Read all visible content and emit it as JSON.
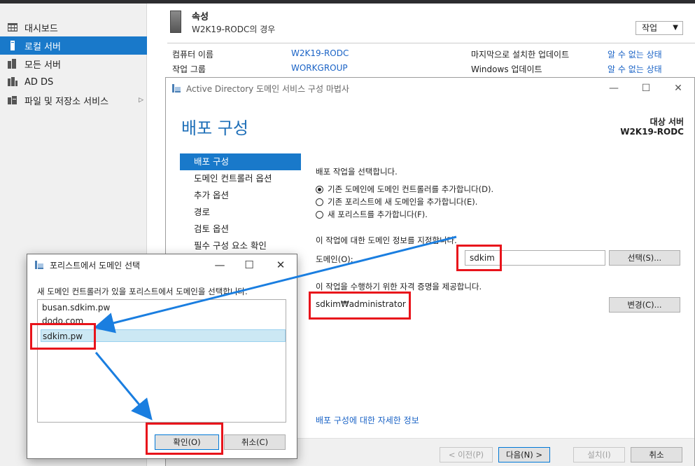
{
  "sidebar": {
    "items": [
      {
        "label": "대시보드",
        "icon": "dashboard-icon"
      },
      {
        "label": "로컬 서버",
        "icon": "server-icon"
      },
      {
        "label": "모든 서버",
        "icon": "servers-icon"
      },
      {
        "label": "AD DS",
        "icon": "ad-ds-icon"
      },
      {
        "label": "파일 및 저장소 서비스",
        "icon": "file-storage-icon",
        "expand": "▷"
      }
    ]
  },
  "properties": {
    "title": "속성",
    "subtitle": "W2K19-RODC의 경우",
    "task_button": "작업",
    "rows": [
      {
        "label": "컴퓨터 이름",
        "value": "W2K19-RODC",
        "label2": "마지막으로 설치한 업데이트",
        "value2": "알 수 없는 상태"
      },
      {
        "label": "작업 그룹",
        "value": "WORKGROUP",
        "label2": "Windows 업데이트",
        "value2": "알 수 없는 상태"
      }
    ]
  },
  "wizard": {
    "title": "Active Directory 도메인 서비스 구성 마법사",
    "heading": "배포 구성",
    "target_label": "대상 서버",
    "target_value": "W2K19-RODC",
    "steps": [
      "배포 구성",
      "도메인 컨트롤러 옵션",
      "추가 옵션",
      "경로",
      "검토 옵션",
      "필수 구성 요소 확인"
    ],
    "select_operation": "배포 작업을 선택합니다.",
    "options": [
      {
        "label": "기존 도메인에 도메인 컨트롤러를 추가합니다(D).",
        "selected": true
      },
      {
        "label": "기존 포리스트에 새 도메인을 추가합니다(E).",
        "selected": false
      },
      {
        "label": "새 포리스트를 추가합니다(F).",
        "selected": false
      }
    ],
    "domain_info": "이 작업에 대한 도메인 정보를 지정합니다.",
    "domain_label": "도메인(O):",
    "domain_value": "sdkim",
    "select_button": "선택(S)...",
    "credentials_info": "이 작업을 수행하기 위한 자격 증명을 제공합니다.",
    "credentials_value": "sdkim₩administrator",
    "change_button": "변경(C)...",
    "more_info_link": "배포 구성에 대한 자세한 정보",
    "buttons": {
      "prev": "< 이전(P)",
      "next": "다음(N) >",
      "install": "설치(I)",
      "cancel": "취소"
    }
  },
  "dialog": {
    "title": "포리스트에서 도메인 선택",
    "prompt": "새 도메인 컨트롤러가 있을 포리스트에서 도메인을 선택합니다.",
    "domains": [
      "busan.sdkim.pw",
      "dodo.com",
      "sdkim.pw"
    ],
    "selected_domain": "sdkim.pw",
    "ok_button": "확인(O)",
    "cancel_button": "취소(C)"
  },
  "colors": {
    "accent": "#1979ca",
    "annotation": "#e8141b",
    "arrow": "#1a7ee0",
    "link": "#1a63c6"
  }
}
